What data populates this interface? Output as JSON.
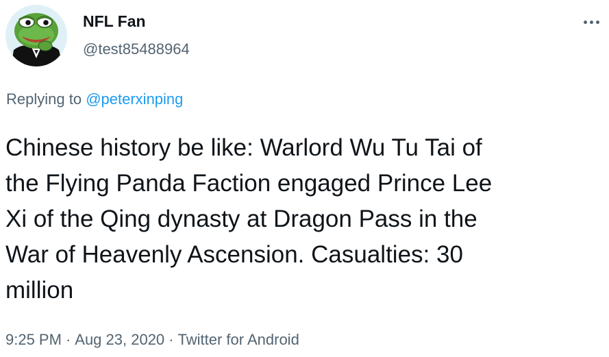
{
  "author": {
    "display_name": "NFL Fan",
    "handle": "@test85488964",
    "avatar_icon": "pepe-frog-avatar"
  },
  "reply": {
    "prefix": "Replying to",
    "mention": "@peterxinping"
  },
  "tweet": {
    "lines": [
      "Chinese history be like: Warlord Wu Tu Tai of",
      "the Flying Panda Faction engaged Prince Lee",
      "Xi of the Qing dynasty at Dragon Pass in the",
      "War of Heavenly Ascension. Casualties: 30",
      "million"
    ]
  },
  "meta": {
    "time": "9:25 PM",
    "separator": "·",
    "date": "Aug 23, 2020",
    "source": "Twitter for Android"
  },
  "icons": {
    "more": "more-options-icon"
  },
  "colors": {
    "text": "#0f1419",
    "secondary": "#536471",
    "link": "#1d9bf0"
  }
}
